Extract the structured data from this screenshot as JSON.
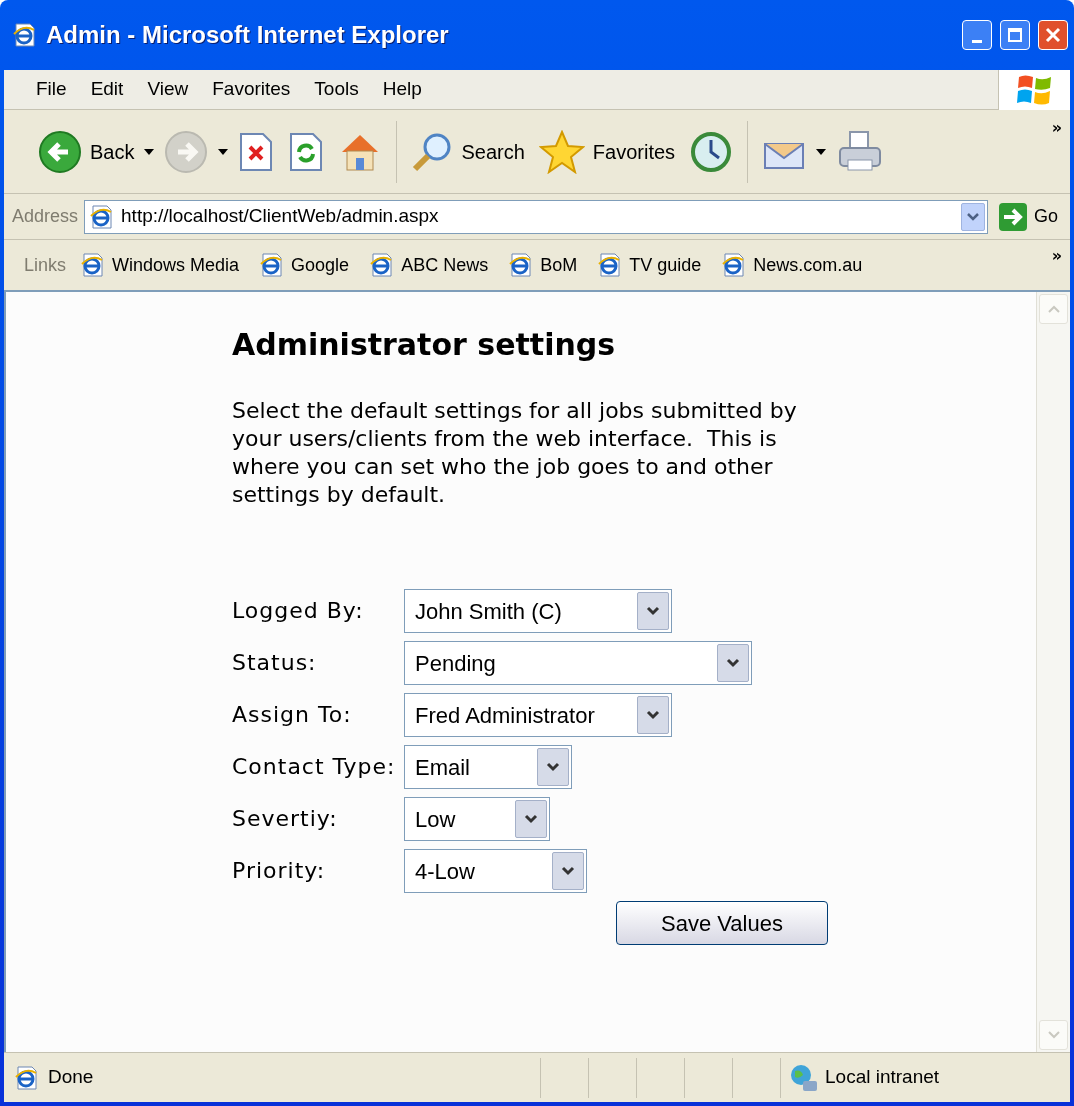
{
  "window": {
    "title": "Admin - Microsoft Internet Explorer"
  },
  "menu": [
    "File",
    "Edit",
    "View",
    "Favorites",
    "Tools",
    "Help"
  ],
  "toolbar": [
    {
      "kind": "back",
      "label": "Back",
      "disabled": false
    },
    {
      "kind": "forward",
      "disabled": true
    },
    {
      "kind": "stop"
    },
    {
      "kind": "refresh"
    },
    {
      "kind": "home"
    },
    {
      "kind": "search",
      "label": "Search"
    },
    {
      "kind": "favorites",
      "label": "Favorites"
    },
    {
      "kind": "history"
    },
    {
      "kind": "mail"
    },
    {
      "kind": "print"
    }
  ],
  "toolbar_overflow": "»",
  "address": {
    "label": "Address",
    "value": "http://localhost/ClientWeb/admin.aspx",
    "go": "Go"
  },
  "links": {
    "label": "Links",
    "items": [
      "Windows Media",
      "Google",
      "ABC News",
      "BoM",
      "TV guide",
      "News.com.au"
    ],
    "overflow": "»"
  },
  "page": {
    "heading": "Administrator settings",
    "intro": "Select the default settings for all jobs submitted by your users/clients from the web interface.  This is where you can set who the job goes to and other settings by default.",
    "fields": [
      {
        "label": "Logged By:",
        "value": "John Smith (C)"
      },
      {
        "label": "Status:",
        "value": "Pending"
      },
      {
        "label": "Assign To:",
        "value": "Fred Administrator"
      },
      {
        "label": "Contact Type:",
        "value": "Email"
      },
      {
        "label": "Severtiy:",
        "value": "Low"
      },
      {
        "label": "Priority:",
        "value": "4-Low"
      }
    ],
    "save_button": "Save Values"
  },
  "status_bar": {
    "text": "Done",
    "zone": "Local intranet"
  }
}
